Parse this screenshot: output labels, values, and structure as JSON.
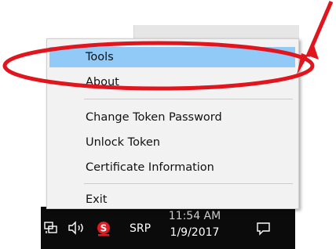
{
  "menu": {
    "items": [
      {
        "label": "Tools"
      },
      {
        "label": "About"
      },
      {
        "label": "Change Token Password"
      },
      {
        "label": "Unlock Token"
      },
      {
        "label": "Certificate Information"
      },
      {
        "label": "Exit"
      }
    ],
    "highlighted_index": 0,
    "highlight_color": "#91c9f7"
  },
  "annotation": {
    "color": "#e0151d"
  },
  "taskbar": {
    "tray_app_label": "SRP",
    "clock_time": "11:54 AM",
    "clock_date": "1/9/2017",
    "icons": [
      "network-icon",
      "volume-icon",
      "srp-tray-icon",
      "action-center-icon"
    ]
  }
}
